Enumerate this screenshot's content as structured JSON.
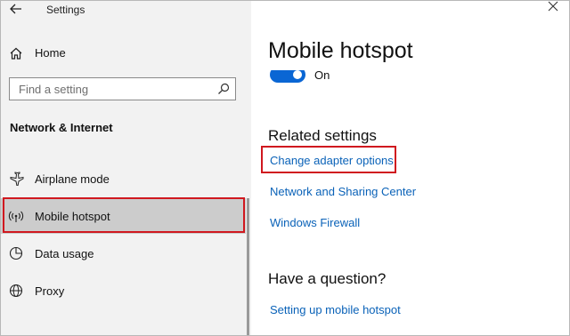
{
  "window": {
    "title": "Settings",
    "back_icon": "back-arrow-icon",
    "close_icon": "close-icon"
  },
  "nav": {
    "home_label": "Home",
    "search_placeholder": "Find a setting",
    "section_heading": "Network & Internet",
    "items": [
      {
        "label": "Airplane mode",
        "icon": "airplane-icon",
        "selected": false
      },
      {
        "label": "Mobile hotspot",
        "icon": "hotspot-icon",
        "selected": true
      },
      {
        "label": "Data usage",
        "icon": "data-usage-icon",
        "selected": false
      },
      {
        "label": "Proxy",
        "icon": "globe-icon",
        "selected": false
      }
    ]
  },
  "main": {
    "title": "Mobile hotspot",
    "toggle": {
      "state": "On",
      "on": true
    },
    "related_heading": "Related settings",
    "related_links": [
      "Change adapter options",
      "Network and Sharing Center",
      "Windows Firewall"
    ],
    "question_heading": "Have a question?",
    "help_link": "Setting up mobile hotspot"
  },
  "colors": {
    "accent": "#0a66d4",
    "link": "#0a62b8",
    "highlight": "#d0181f",
    "nav_bg": "#f2f2f2",
    "selected_bg": "#cccccc"
  }
}
